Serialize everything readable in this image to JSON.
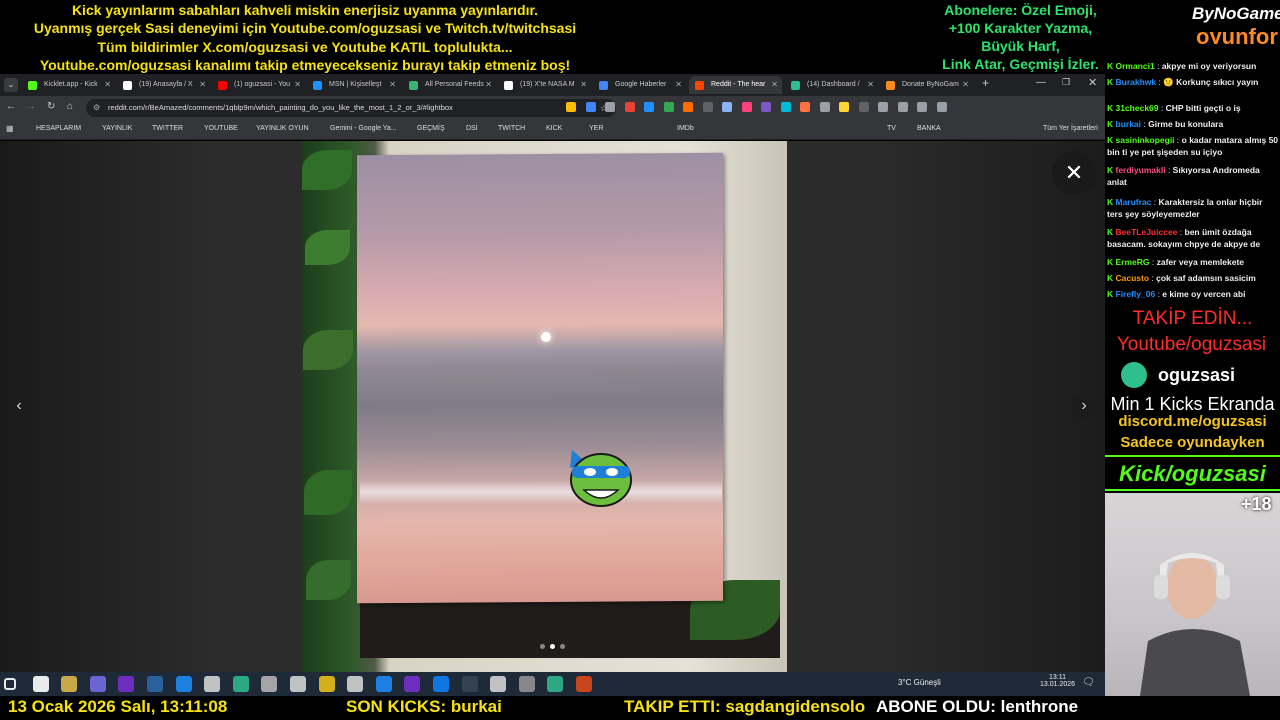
{
  "overlay_top": {
    "line1": "Kick yayınlarım sabahları kahveli miskin enerjisiz uyanma yayınlarıdır.",
    "line2": "Uyanmış gerçek Sasi deneyimi için Youtube.com/oguzsasi ve Twitch.tv/twitchsasi",
    "line3": "Tüm bildirimler X.com/oguzsasi ve Youtube KATIL toplulukta...",
    "line4": "Youtube.com/oguzsasi kanalımı takip etmeyecekseniz burayı takip etmeniz boş!",
    "right1": "Abonelere: Özel Emoji,",
    "right2": "+100 Karakter Yazma,",
    "right3": "Büyük Harf,",
    "right4": "Link Atar, Geçmişi İzler.",
    "logo_top": "ByNoGame",
    "logo_bottom": "oyunfor"
  },
  "browser": {
    "tabs": [
      {
        "label": "Kicklet.app - Kick",
        "color": "#53fc18"
      },
      {
        "label": "(19) Anasayfa / X",
        "color": "#ffffff"
      },
      {
        "label": "(1) oguzsasi - You",
        "color": "#ff0000"
      },
      {
        "label": "MSN | Kişiselleşt",
        "color": "#1e90ff"
      },
      {
        "label": "All Personal Feeds",
        "color": "#3cb371"
      },
      {
        "label": "(19) X'te NASA M",
        "color": "#ffffff"
      },
      {
        "label": "Google Haberler",
        "color": "#4285f4"
      },
      {
        "label": "Reddit - The hear",
        "color": "#ff4500"
      },
      {
        "label": "(14) Dashboard /",
        "color": "#2fbf8f"
      },
      {
        "label": "Donate ByNoGam",
        "color": "#ff8a1e"
      }
    ],
    "new_tab": "+",
    "url": "reddit.com/r/BeAmazed/comments/1qblp9m/which_painting_do_you_like_the_most_1_2_or_3/#lightbox",
    "bookmarks": [
      "HESAPLARIM",
      "YAYINLIK",
      "TWITTER",
      "YOUTUBE",
      "YAYINLIK OYUN",
      "Gemini - Google Ya...",
      "GEÇMİŞ",
      "DSİ",
      "TWITCH",
      "KICK",
      "YER",
      "IMDb",
      "TV",
      "BANKA"
    ],
    "all_bookmarks": "Tüm Yer İşaretleri"
  },
  "lightbox": {
    "close": "✕",
    "prev": "‹",
    "next": "›",
    "slides": 3,
    "active_slide": 2
  },
  "taskbar": {
    "weather": "3°C  Güneşli",
    "time": "13:11",
    "date": "13.01.2026"
  },
  "chat": [
    {
      "user": "Ormanci1",
      "color": "#53fc18",
      "text": "akpye mi oy veriyorsun"
    },
    {
      "user": "Burakhwk",
      "color": "#1e90ff",
      "text": "🙁 Korkunç sıkıcı yayın"
    },
    {
      "user": "31check69",
      "color": "#53fc18",
      "text": "CHP bitti geçti o iş"
    },
    {
      "user": "burkai",
      "color": "#1e90ff",
      "text": "Girme bu konulara"
    },
    {
      "user": "sasininkopegii",
      "color": "#53fc18",
      "text": "o kadar matara almış 50 bin ti ye pet şişeden su içiyo"
    },
    {
      "user": "ferdiyumakli",
      "color": "#ff4a8a",
      "text": "Sıkıyorsa Andromeda anlat"
    },
    {
      "user": "Marufrac",
      "color": "#1e90ff",
      "text": "Karaktersiz la onlar hiçbir ters şey söyleyemezler"
    },
    {
      "user": "BeeTLeJuiccee",
      "color": "#ff3030",
      "text": "ben ümit özdağa basacam. sokayım chpye de akpye de"
    },
    {
      "user": "ErmeRG",
      "color": "#53fc18",
      "text": "zafer veya memlekete"
    },
    {
      "user": "Cacusto",
      "color": "#ff9a00",
      "text": "çok saf adamsın sasicim"
    },
    {
      "user": "Firefly_06",
      "color": "#1e90ff",
      "text": "e kime oy vercen abi"
    }
  ],
  "side_overlay": {
    "follow1": "TAKİP EDİN...",
    "follow2": "Youtube/oguzsasi",
    "kick_name": "oguzsasi",
    "min_kicks": "Min 1 Kicks Ekranda",
    "discord": "discord.me/oguzsasi",
    "only_game": "Sadece oyundayken",
    "kick_link": "Kick/oguzsasi",
    "age": "+18"
  },
  "overlay_bottom": {
    "datetime": "13 Ocak 2026 Salı, 13:11:08",
    "last_kicks": "SON KICKS: burkai",
    "followed": "TAKIP ETTI: sagdangidensolo",
    "subscribed": "ABONE OLDU: lenthrone"
  }
}
